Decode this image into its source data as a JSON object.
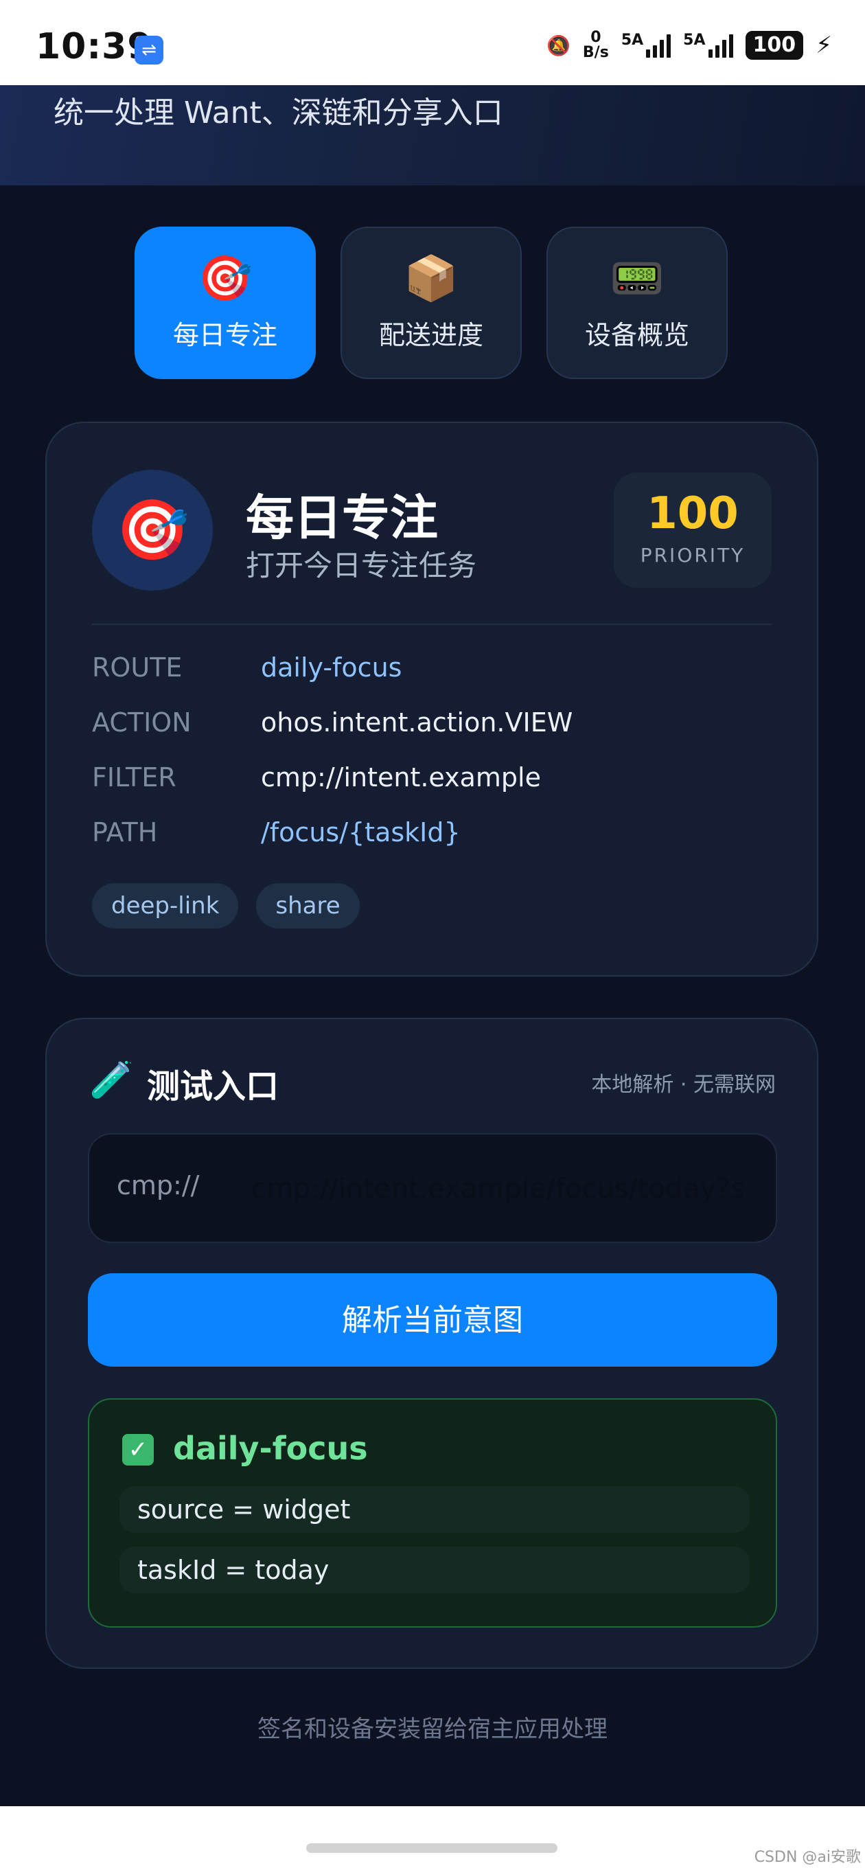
{
  "status_bar": {
    "time": "10:39",
    "usb_icon": "usb-icon",
    "speed_value": "0",
    "speed_unit": "B/s",
    "net1": "5A",
    "net2": "5A",
    "battery": "100"
  },
  "header": {
    "subtitle": "统一处理 Want、深链和分享入口"
  },
  "tabs": [
    {
      "icon": "🎯",
      "label": "每日专注",
      "active": true
    },
    {
      "icon": "📦",
      "label": "配送进度",
      "active": false
    },
    {
      "icon": "📟",
      "label": "设备概览",
      "active": false
    }
  ],
  "detail": {
    "icon": "🎯",
    "title": "每日专注",
    "subtitle": "打开今日专注任务",
    "priority_value": "100",
    "priority_label": "PRIORITY",
    "fields": [
      {
        "key": "ROUTE",
        "value": "daily-focus"
      },
      {
        "key": "ACTION",
        "value": "ohos.intent.action.VIEW"
      },
      {
        "key": "FILTER",
        "value": "cmp://intent.example"
      },
      {
        "key": "PATH",
        "value": "/focus/{taskId}"
      }
    ],
    "chips": [
      "deep-link",
      "share"
    ]
  },
  "test": {
    "icon": "🧪",
    "title": "测试入口",
    "note": "本地解析 · 无需联网",
    "prefix": "cmp://",
    "input_value": "cmp://intent.example/focus/today?s",
    "button_label": "解析当前意图",
    "result": {
      "route": "daily-focus",
      "params": [
        "source = widget",
        "taskId = today"
      ]
    }
  },
  "footer": {
    "note": "签名和设备安装留给宿主应用处理",
    "watermark": "CSDN @ai安歌"
  }
}
